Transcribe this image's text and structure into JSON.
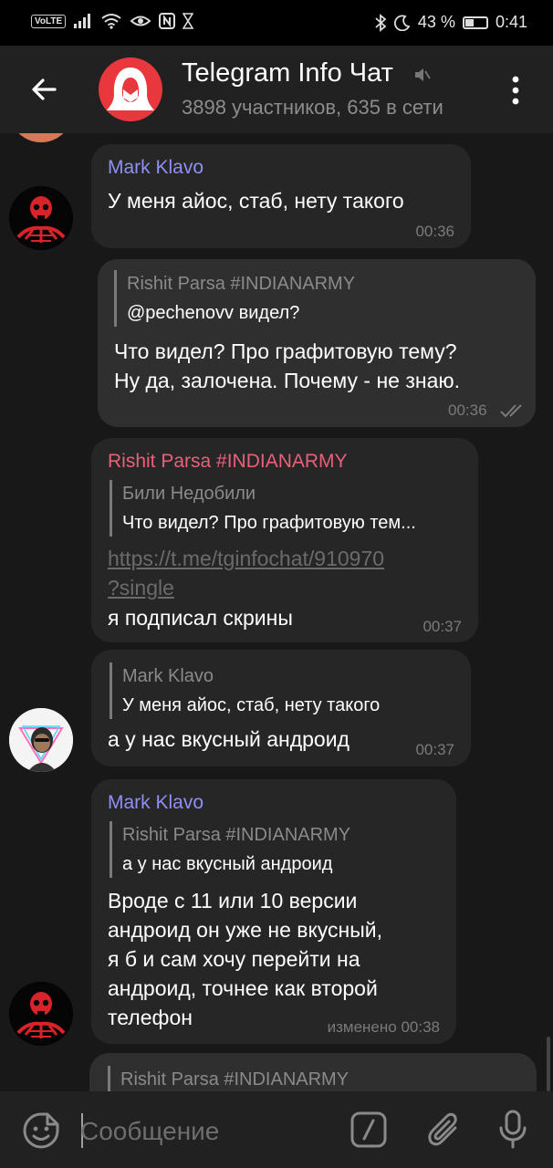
{
  "status_bar": {
    "volte": "VoLTE",
    "battery_percent": "43 %",
    "battery_level": 0.43,
    "time": "0:41"
  },
  "header": {
    "title": "Telegram Info Чат",
    "subtitle": "3898 участников, 635 в сети"
  },
  "messages": [
    {
      "sender": "Mark Klavo",
      "sender_color": "#8f8ff5",
      "text": "У меня айос, стаб, нету такого",
      "time": "00:36"
    },
    {
      "reply_name": "Rishit Parsa #INDIANARMY",
      "reply_text": "@pechenovv видел?",
      "lines": [
        "Что видел? Про графитовую тему?",
        "Ну да, залочена. Почему - не знаю."
      ],
      "time": "00:36",
      "outgoing": true
    },
    {
      "sender": "Rishit Parsa #INDIANARMY",
      "sender_color": "#e8607a",
      "reply_name": "Били Недобили",
      "reply_text": "Что видел? Про графитовую тем...",
      "link_lines": [
        "https://t.me/tginfochat/910970",
        "?single"
      ],
      "text": "я подписал скрины",
      "time": "00:37"
    },
    {
      "reply_name": "Mark Klavo",
      "reply_text": "У меня айос, стаб, нету такого",
      "text": "а у нас вкусный андроид",
      "time": "00:37"
    },
    {
      "sender": "Mark Klavo",
      "sender_color": "#8f8ff5",
      "reply_name": "Rishit Parsa #INDIANARMY",
      "reply_text": "а у нас вкусный андроид",
      "lines": [
        "Вроде с 11 или 10 версии",
        "андроид он уже не вкусный,",
        "я б и сам хочу перейти на",
        "андроид, точнее как второй",
        "телефон"
      ],
      "time": "изменено 00:38"
    },
    {
      "reply_name": "Rishit Parsa #INDIANARMY"
    }
  ],
  "composer": {
    "placeholder": "Сообщение"
  },
  "icons": {
    "back": "arrow-left-icon",
    "mute": "muted-speaker-icon",
    "menu": "more-vertical-icon",
    "emoji": "sticker-emoji-icon",
    "command": "bot-command-icon",
    "attach": "paperclip-icon",
    "mic": "microphone-icon",
    "read": "double-check-icon"
  }
}
